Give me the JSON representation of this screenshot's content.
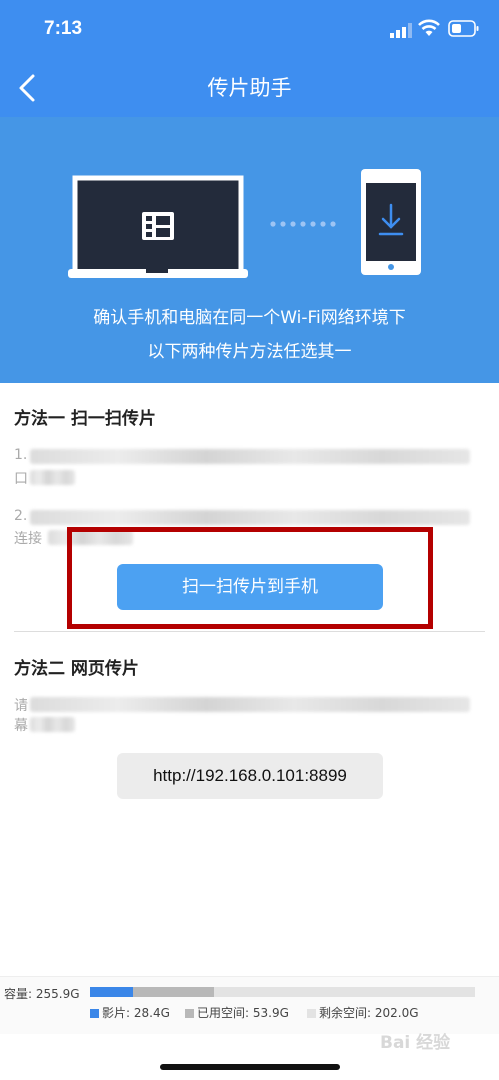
{
  "status_bar": {
    "time": "7:13"
  },
  "nav": {
    "title": "传片助手"
  },
  "hero": {
    "line1": "确认手机和电脑在同一个Wi-Fi网络环境下",
    "line2": "以下两种传片方法任选其一"
  },
  "method1": {
    "title": "方法一 扫一扫传片",
    "step1_prefix": "1.",
    "step1_line2_prefix": "口",
    "step2_prefix": "2.",
    "step2_line2_prefix": "连接",
    "button_label": "扫一扫传片到手机"
  },
  "method2": {
    "title": "方法二 网页传片",
    "text_prefix": "请",
    "text_line2_prefix": "幕",
    "url": "http://192.168.0.101:8899"
  },
  "storage": {
    "capacity_label": "容量: 255.9G",
    "legend": [
      {
        "label": "影片: 28.4G",
        "color": "#3a86e8"
      },
      {
        "label": "已用空间: 53.9G",
        "color": "#b8b8b8"
      },
      {
        "label": "剩余空间: 202.0G",
        "color": "#e3e3e3"
      }
    ],
    "fractions": {
      "movies": 0.111,
      "used": 0.211
    }
  },
  "watermark": "Bai 经验"
}
